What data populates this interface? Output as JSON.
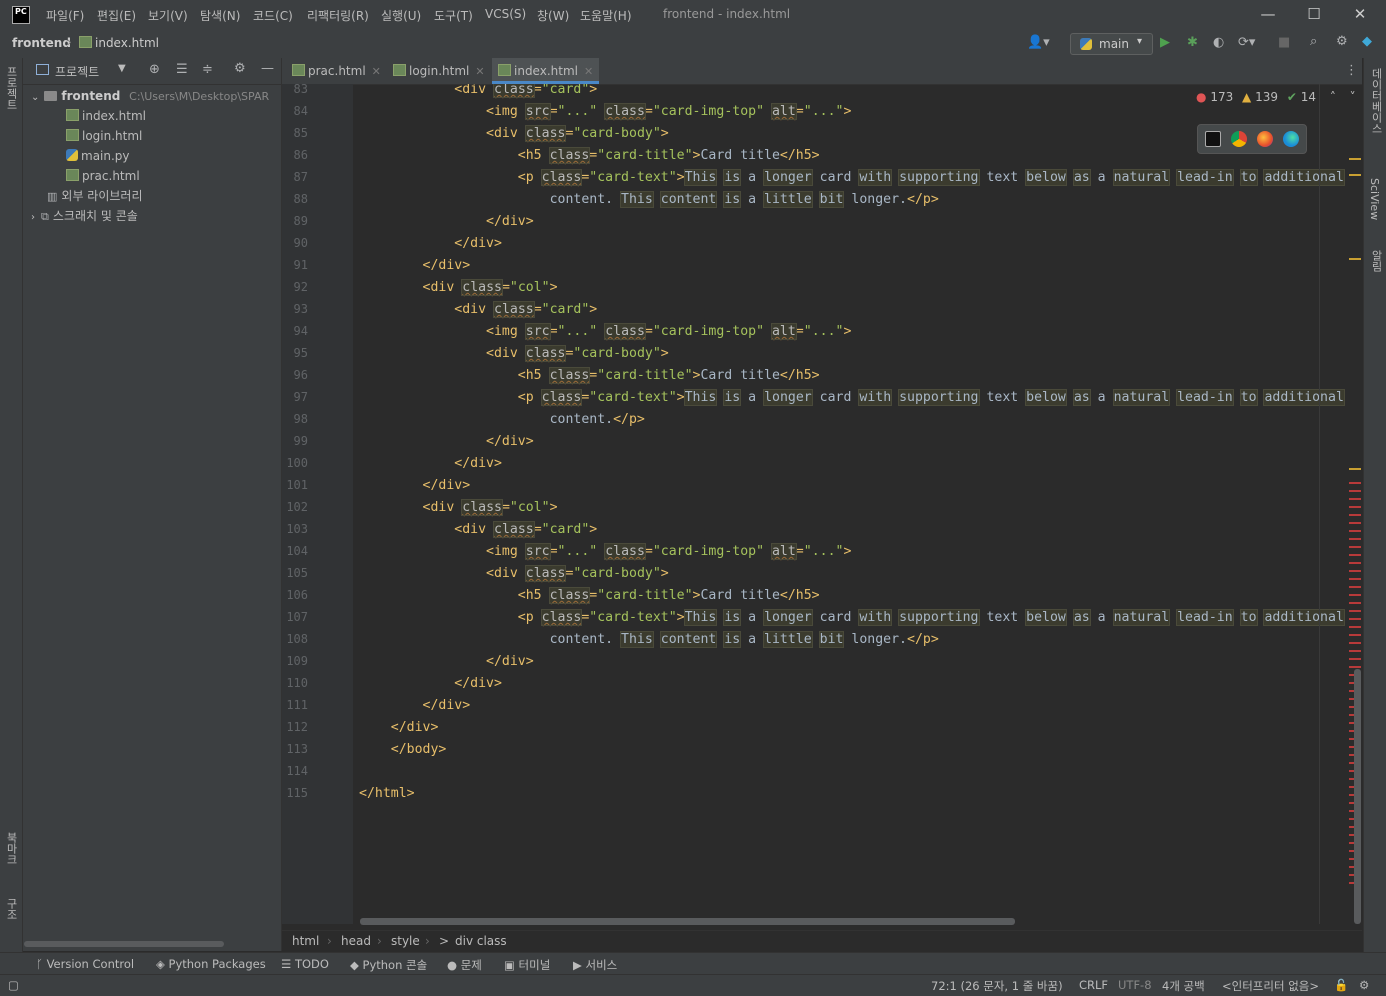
{
  "window": {
    "app_logo": "PC",
    "title": "frontend - index.html",
    "menu": [
      "파일(F)",
      "편집(E)",
      "보기(V)",
      "탐색(N)",
      "코드(C)",
      "리팩터링(R)",
      "실행(U)",
      "도구(T)",
      "VCS(S)",
      "창(W)",
      "도움말(H)"
    ],
    "controls": {
      "minimize": "—",
      "maximize": "☐",
      "close": "✕"
    }
  },
  "navbar": {
    "project": "frontend",
    "separator": "›",
    "file": "index.html",
    "run_config": "main"
  },
  "left_tabs": {
    "project": "프로젝트",
    "bookmarks": "북마크",
    "structure": "구조"
  },
  "right_tabs": {
    "database": "데이터베이스",
    "sciview": "SciView",
    "notifications": "알림"
  },
  "project_panel": {
    "title": "프로젝트",
    "tree": [
      {
        "label": "frontend",
        "path": "C:\\Users\\M\\Desktop\\SPAR",
        "kind": "root"
      },
      {
        "label": "index.html",
        "kind": "html"
      },
      {
        "label": "login.html",
        "kind": "html"
      },
      {
        "label": "main.py",
        "kind": "py"
      },
      {
        "label": "prac.html",
        "kind": "html"
      },
      {
        "label": "외부 라이브러리",
        "kind": "lib"
      },
      {
        "label": "스크래치 및 콘솔",
        "kind": "scratch"
      }
    ]
  },
  "tabs": [
    {
      "label": "prac.html",
      "active": false
    },
    {
      "label": "login.html",
      "active": false
    },
    {
      "label": "index.html",
      "active": true
    }
  ],
  "inspections": {
    "errors": "173",
    "warnings": "139",
    "weak": "14"
  },
  "code": {
    "line_numbers": [
      "83",
      "84",
      "85",
      "86",
      "87",
      "88",
      "89",
      "90",
      "91",
      "92",
      "93",
      "94",
      "95",
      "96",
      "97",
      "98",
      "99",
      "100",
      "101",
      "102",
      "103",
      "104",
      "105",
      "106",
      "107",
      "108",
      "109",
      "110",
      "111",
      "112",
      "113",
      "114",
      "115"
    ],
    "lines": [
      "            <div class=\"card\">",
      "                <img src=\"...\" class=\"card-img-top\" alt=\"...\">",
      "                <div class=\"card-body\">",
      "                    <h5 class=\"card-title\">Card title</h5>",
      "                    <p class=\"card-text\">This is a longer card with supporting text below as a natural lead-in to additional",
      "                        content. This content is a little bit longer.</p>",
      "                </div>",
      "            </div>",
      "        </div>",
      "        <div class=\"col\">",
      "            <div class=\"card\">",
      "                <img src=\"...\" class=\"card-img-top\" alt=\"...\">",
      "                <div class=\"card-body\">",
      "                    <h5 class=\"card-title\">Card title</h5>",
      "                    <p class=\"card-text\">This is a longer card with supporting text below as a natural lead-in to additional",
      "                        content.</p>",
      "                </div>",
      "            </div>",
      "        </div>",
      "        <div class=\"col\">",
      "            <div class=\"card\">",
      "                <img src=\"...\" class=\"card-img-top\" alt=\"...\">",
      "                <div class=\"card-body\">",
      "                    <h5 class=\"card-title\">Card title</h5>",
      "                    <p class=\"card-text\">This is a longer card with supporting text below as a natural lead-in to additional",
      "                        content. This content is a little bit longer.</p>",
      "                </div>",
      "            </div>",
      "        </div>",
      "    </div>",
      "    </body>",
      "",
      "</html>"
    ]
  },
  "breadcrumbs": [
    "html",
    "head",
    "style",
    ">",
    "div class"
  ],
  "tool_windows": [
    "Version Control",
    "Python Packages",
    "TODO",
    "Python 콘솔",
    "문제",
    "터미널",
    "서비스"
  ],
  "status": {
    "position": "72:1 (26 문자, 1 줄 바꿈)",
    "line_sep": "CRLF",
    "encoding": "UTF-8",
    "indent": "4개 공백",
    "interpreter": "<인터프리터 없음>"
  },
  "colors": {
    "tag": "#e8bf6a",
    "string": "#a5c25c",
    "attribute": "#bababa",
    "background": "#2b2b2b"
  }
}
